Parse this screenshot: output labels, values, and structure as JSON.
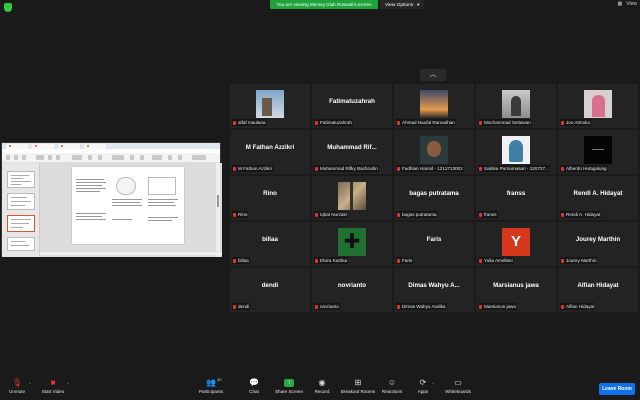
{
  "top_bar": {
    "share_banner": "You are viewing Mersey Diah Roswati's screen",
    "view_options": "View Options",
    "view_label": "View",
    "shield_icon": "shield-icon"
  },
  "shared_screen": {
    "tabs": [
      "",
      "",
      "",
      ""
    ],
    "menu": "",
    "slide_title": ""
  },
  "gallery": {
    "collapse_icon": "chevron-up-icon",
    "tiles": [
      {
        "display": "",
        "label": "alfaf maulana",
        "avatar": "av-sky"
      },
      {
        "display": "Fatimatuzahrah",
        "label": "Fatimatuzahrah",
        "avatar": ""
      },
      {
        "display": "",
        "label": "Ahmad Naufal Ramadhan",
        "avatar": "av-sunset"
      },
      {
        "display": "",
        "label": "Mochammad Setiawan",
        "avatar": "av-grey"
      },
      {
        "display": "",
        "label": "Joo Atmoko",
        "avatar": "av-pink"
      },
      {
        "display": "M Fathan Azzikri",
        "label": "M Fathan Azzikri",
        "avatar": ""
      },
      {
        "display": "Muhammad  Rif...",
        "label": "Muhammad Rifky Bachrudin",
        "avatar": ""
      },
      {
        "display": "",
        "label": "Fadhlan Hamid - 1212713002",
        "avatar": "av-face"
      },
      {
        "display": "",
        "label": "Sartika Purnamasari - 120727...",
        "avatar": "av-hijab"
      },
      {
        "display": "",
        "label": "Alberdo Hutagalung",
        "avatar": "av-dark"
      },
      {
        "display": "Rino",
        "label": "Rino",
        "avatar": ""
      },
      {
        "display": "",
        "label": "Iqbal Nurzaki",
        "avatar": "av-street"
      },
      {
        "display": "bagas putratama",
        "label": "bagas putratama",
        "avatar": ""
      },
      {
        "display": "franss",
        "label": "franss",
        "avatar": ""
      },
      {
        "display": "Rendi A. Hidayat",
        "label": "Rendi A. Hidayat",
        "avatar": ""
      },
      {
        "display": "billaa",
        "label": "billaa",
        "avatar": ""
      },
      {
        "display": "",
        "label": "Elvira Kartika",
        "avatar": "av-gear"
      },
      {
        "display": "Faris",
        "label": "Faris",
        "avatar": ""
      },
      {
        "display": "",
        "label": "Yulia Amellani",
        "avatar": "av-letter",
        "avatar_text": "Y"
      },
      {
        "display": "Jourey Marthin",
        "label": "Jourey Marthin",
        "avatar": ""
      },
      {
        "display": "dendi",
        "label": "dendi",
        "avatar": ""
      },
      {
        "display": "novrianto",
        "label": "novrianto",
        "avatar": ""
      },
      {
        "display": "Dimas Wahyu A...",
        "label": "Dimas Wahyu Andika",
        "avatar": ""
      },
      {
        "display": "Marsianus jawa",
        "label": "Marsianus jawa",
        "avatar": ""
      },
      {
        "display": "Alfian Hidayat",
        "label": "Alfian Hidayat",
        "avatar": ""
      }
    ]
  },
  "toolbar": {
    "unmute": "Unmute",
    "start_video": "Start Video",
    "participants": "Participants",
    "participants_count": "30",
    "chat": "Chat",
    "share_screen": "Share Screen",
    "record": "Record",
    "breakout_rooms": "Breakout Rooms",
    "reactions": "Reactions",
    "apps": "Apps",
    "whiteboards": "Whiteboards",
    "leave_room": "Leave Room"
  },
  "colors": {
    "background": "#1a1a1a",
    "tile": "#232323",
    "share_banner": "#1fa33a",
    "leave_button": "#0e72ed",
    "muted_mic": "#e0362d"
  }
}
